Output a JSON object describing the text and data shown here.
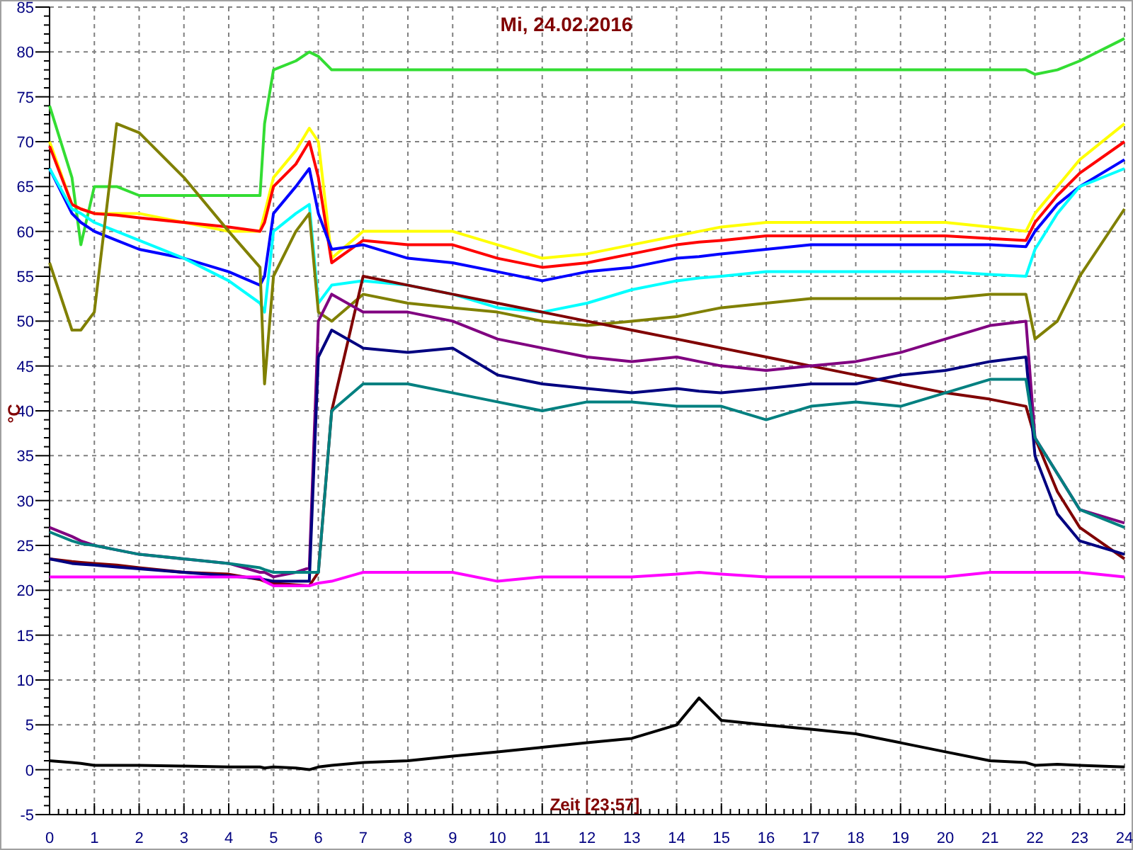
{
  "chart_data": {
    "type": "line",
    "grid": true,
    "title": "Mi, 24.02.2016",
    "xlabel": "Zeit [23:57]",
    "ylabel": "°C",
    "x": [
      0,
      0.5,
      0.7,
      1,
      1.5,
      2,
      3,
      4,
      4.7,
      4.8,
      5,
      5.5,
      5.8,
      6,
      6.3,
      7,
      8,
      9,
      10,
      11,
      12,
      13,
      14,
      14.5,
      15,
      16,
      17,
      18,
      19,
      20,
      21,
      21.8,
      22,
      22.5,
      23,
      24
    ],
    "xlim": [
      0,
      24
    ],
    "ylim": [
      -5,
      85
    ],
    "xticks": [
      0,
      1,
      2,
      3,
      4,
      5,
      6,
      7,
      8,
      9,
      10,
      11,
      12,
      13,
      14,
      15,
      16,
      17,
      18,
      19,
      20,
      21,
      22,
      23,
      24
    ],
    "yticks": [
      -5,
      0,
      5,
      10,
      15,
      20,
      25,
      30,
      35,
      40,
      45,
      50,
      55,
      60,
      65,
      70,
      75,
      80,
      85
    ],
    "series": [
      {
        "color": "#33dd33",
        "values": [
          74,
          66,
          58.5,
          65,
          65,
          64,
          64,
          64,
          64,
          72,
          78,
          79,
          80,
          79.5,
          78,
          78,
          78,
          78,
          78,
          78,
          78,
          78,
          78,
          78,
          78,
          78,
          78,
          78,
          78,
          78,
          78,
          78,
          77.5,
          78,
          79,
          81.5
        ]
      },
      {
        "color": "#ffff00",
        "values": [
          70,
          63,
          62.5,
          62,
          62,
          62,
          61,
          60,
          60,
          62,
          66,
          69,
          71.5,
          70,
          57,
          60,
          60,
          60,
          58.5,
          57,
          57.5,
          58.5,
          59.5,
          60,
          60.5,
          61,
          61,
          61,
          61,
          61,
          60.5,
          60,
          62,
          65,
          68,
          72
        ]
      },
      {
        "color": "#ff0000",
        "values": [
          69.5,
          63,
          62.5,
          62,
          61.8,
          61.5,
          61,
          60.5,
          60,
          61,
          65,
          67.5,
          70,
          66,
          56.5,
          59,
          58.5,
          58.5,
          57,
          56,
          56.5,
          57.5,
          58.5,
          58.8,
          59,
          59.5,
          59.5,
          59.5,
          59.5,
          59.5,
          59.2,
          59,
          61,
          64,
          66.5,
          70
        ]
      },
      {
        "color": "#0000ff",
        "values": [
          67,
          62,
          61,
          60,
          59,
          58,
          57,
          55.5,
          54,
          55,
          62,
          65,
          67,
          62,
          58,
          58.5,
          57,
          56.5,
          55.5,
          54.5,
          55.5,
          56,
          57,
          57.2,
          57.5,
          58,
          58.5,
          58.5,
          58.5,
          58.5,
          58.5,
          58.3,
          60,
          63,
          65,
          68
        ]
      },
      {
        "color": "#00ffff",
        "values": [
          67,
          62.5,
          62,
          61,
          60,
          59,
          57,
          54.5,
          52,
          51,
          60,
          62,
          63,
          52,
          54,
          54.5,
          54,
          53,
          51.5,
          51,
          52,
          53.5,
          54.5,
          54.8,
          55,
          55.5,
          55.5,
          55.5,
          55.5,
          55.5,
          55.2,
          55,
          58,
          62,
          65,
          67
        ]
      },
      {
        "color": "#808000",
        "values": [
          56.5,
          49,
          49,
          51,
          72,
          71,
          66,
          60,
          56,
          43,
          55,
          60,
          62,
          51,
          50,
          53,
          52,
          51.5,
          51,
          50,
          49.5,
          50,
          50.5,
          51,
          51.5,
          52,
          52.5,
          52.5,
          52.5,
          52.5,
          53,
          53,
          48,
          50,
          55,
          62.5
        ]
      },
      {
        "color": "#800000",
        "values": [
          23.5,
          23.2,
          23.1,
          23,
          22.8,
          22.5,
          22,
          21.8,
          21.2,
          21,
          20.8,
          20.6,
          20.5,
          22,
          40,
          55,
          54,
          53,
          52,
          51,
          50,
          49,
          48,
          47.5,
          47,
          46,
          45,
          44,
          43,
          42,
          41.3,
          40.5,
          37,
          31,
          27,
          23.5
        ]
      },
      {
        "color": "#800080",
        "values": [
          27,
          26,
          25.5,
          25,
          24.5,
          24,
          23.5,
          23,
          22,
          22,
          21.5,
          22,
          22.5,
          50,
          53,
          51,
          51,
          50,
          48,
          47,
          46,
          45.5,
          46,
          45.5,
          45,
          44.5,
          45,
          45.5,
          46.5,
          48,
          49.5,
          50,
          37,
          33,
          29,
          27.5
        ]
      },
      {
        "color": "#000080",
        "values": [
          23.5,
          23,
          22.9,
          22.8,
          22.6,
          22.4,
          22,
          21.6,
          21.3,
          21.2,
          21,
          21,
          21,
          46,
          49,
          47,
          46.5,
          47,
          44,
          43,
          42.5,
          42,
          42.5,
          42.2,
          42,
          42.5,
          43,
          43,
          44,
          44.5,
          45.5,
          46,
          35,
          28.5,
          25.5,
          24
        ]
      },
      {
        "color": "#008080",
        "values": [
          26.5,
          25.5,
          25.2,
          25,
          24.5,
          24,
          23.5,
          23,
          22.5,
          22.3,
          22,
          22,
          22,
          22,
          40,
          43,
          43,
          42,
          41,
          40,
          41,
          41,
          40.5,
          40.5,
          40.5,
          39,
          40.5,
          41,
          40.5,
          42,
          43.5,
          43.5,
          37,
          33,
          29,
          27
        ]
      },
      {
        "color": "#ff00ff",
        "values": [
          21.5,
          21.5,
          21.5,
          21.5,
          21.5,
          21.5,
          21.5,
          21.5,
          21.5,
          21,
          20.5,
          20.5,
          20.5,
          20.8,
          21,
          22,
          22,
          22,
          21,
          21.5,
          21.5,
          21.5,
          21.8,
          22,
          21.8,
          21.5,
          21.5,
          21.5,
          21.5,
          21.5,
          22,
          22,
          22,
          22,
          22,
          21.5
        ]
      },
      {
        "color": "#000000",
        "values": [
          1,
          0.8,
          0.7,
          0.5,
          0.5,
          0.5,
          0.4,
          0.3,
          0.3,
          0.2,
          0.3,
          0.2,
          0,
          0.3,
          0.5,
          0.8,
          1,
          1.5,
          2,
          2.5,
          3,
          3.5,
          5,
          8,
          5.5,
          5,
          4.5,
          4,
          3,
          2,
          1,
          0.8,
          0.5,
          0.6,
          0.5,
          0.3
        ]
      }
    ]
  }
}
